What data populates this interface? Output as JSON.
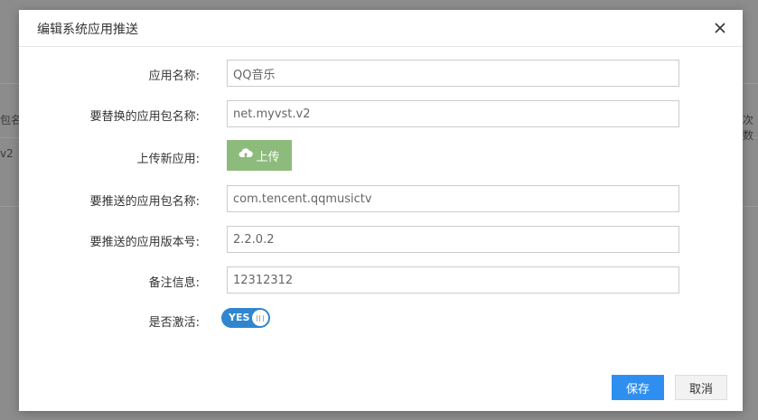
{
  "background": {
    "left_header_fragment": "包名称",
    "left_cell_fragment": "v2",
    "right_header_fragment": "次数"
  },
  "dialog": {
    "title": "编辑系统应用推送",
    "close_icon": "close-icon"
  },
  "form": {
    "app_name": {
      "label": "应用名称:",
      "value": "QQ音乐"
    },
    "replace_package": {
      "label": "要替换的应用包名称:",
      "value": "net.myvst.v2"
    },
    "upload": {
      "label": "上传新应用:",
      "button_label": "上传",
      "icon": "cloud-upload-icon"
    },
    "push_package": {
      "label": "要推送的应用包名称:",
      "value": "com.tencent.qqmusictv"
    },
    "push_version": {
      "label": "要推送的应用版本号:",
      "value": "2.2.0.2"
    },
    "remark": {
      "label": "备注信息:",
      "value": "12312312"
    },
    "active": {
      "label": "是否激活:",
      "toggle_text": "YES",
      "checked": true
    }
  },
  "footer": {
    "save_label": "保存",
    "cancel_label": "取消"
  },
  "colors": {
    "primary": "#2f8ff0",
    "upload_green": "#8dbb7c",
    "toggle_blue": "#2f86cf",
    "overlay": "#8c8c8c"
  }
}
